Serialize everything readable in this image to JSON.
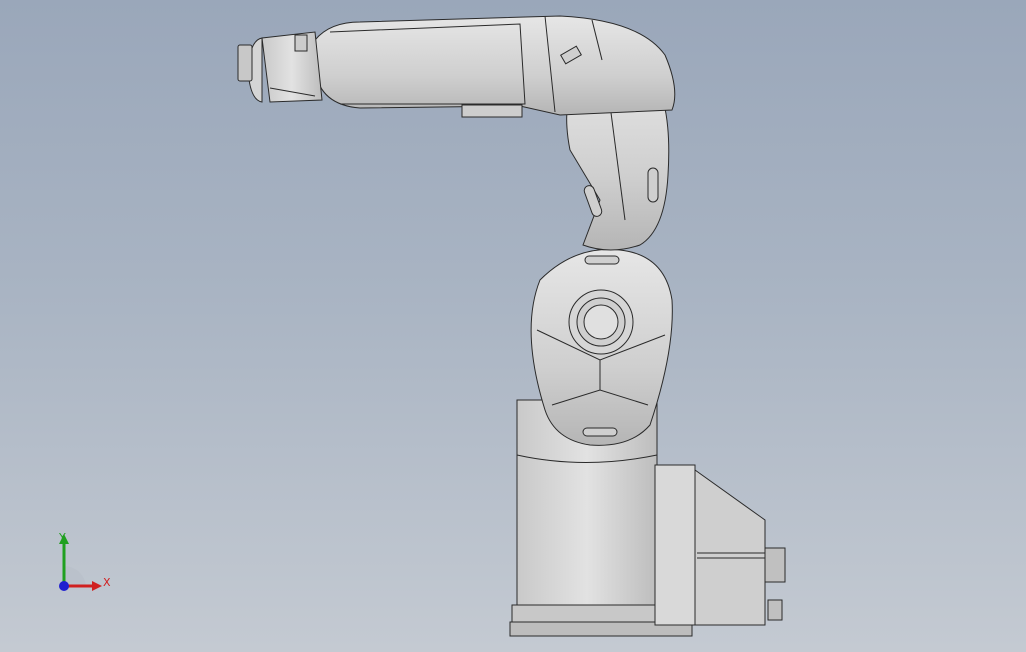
{
  "triad": {
    "x_label": "X",
    "y_label": "Y",
    "x_color": "#d02020",
    "y_color": "#20a020",
    "z_color": "#2020d0"
  },
  "model": {
    "type": "6-axis robot arm",
    "view": "side view"
  },
  "colors": {
    "background_top": "#9aa7ba",
    "background_bottom": "#c4cad2",
    "body": "#d3d3d3",
    "edges": "#2a2a2a"
  }
}
